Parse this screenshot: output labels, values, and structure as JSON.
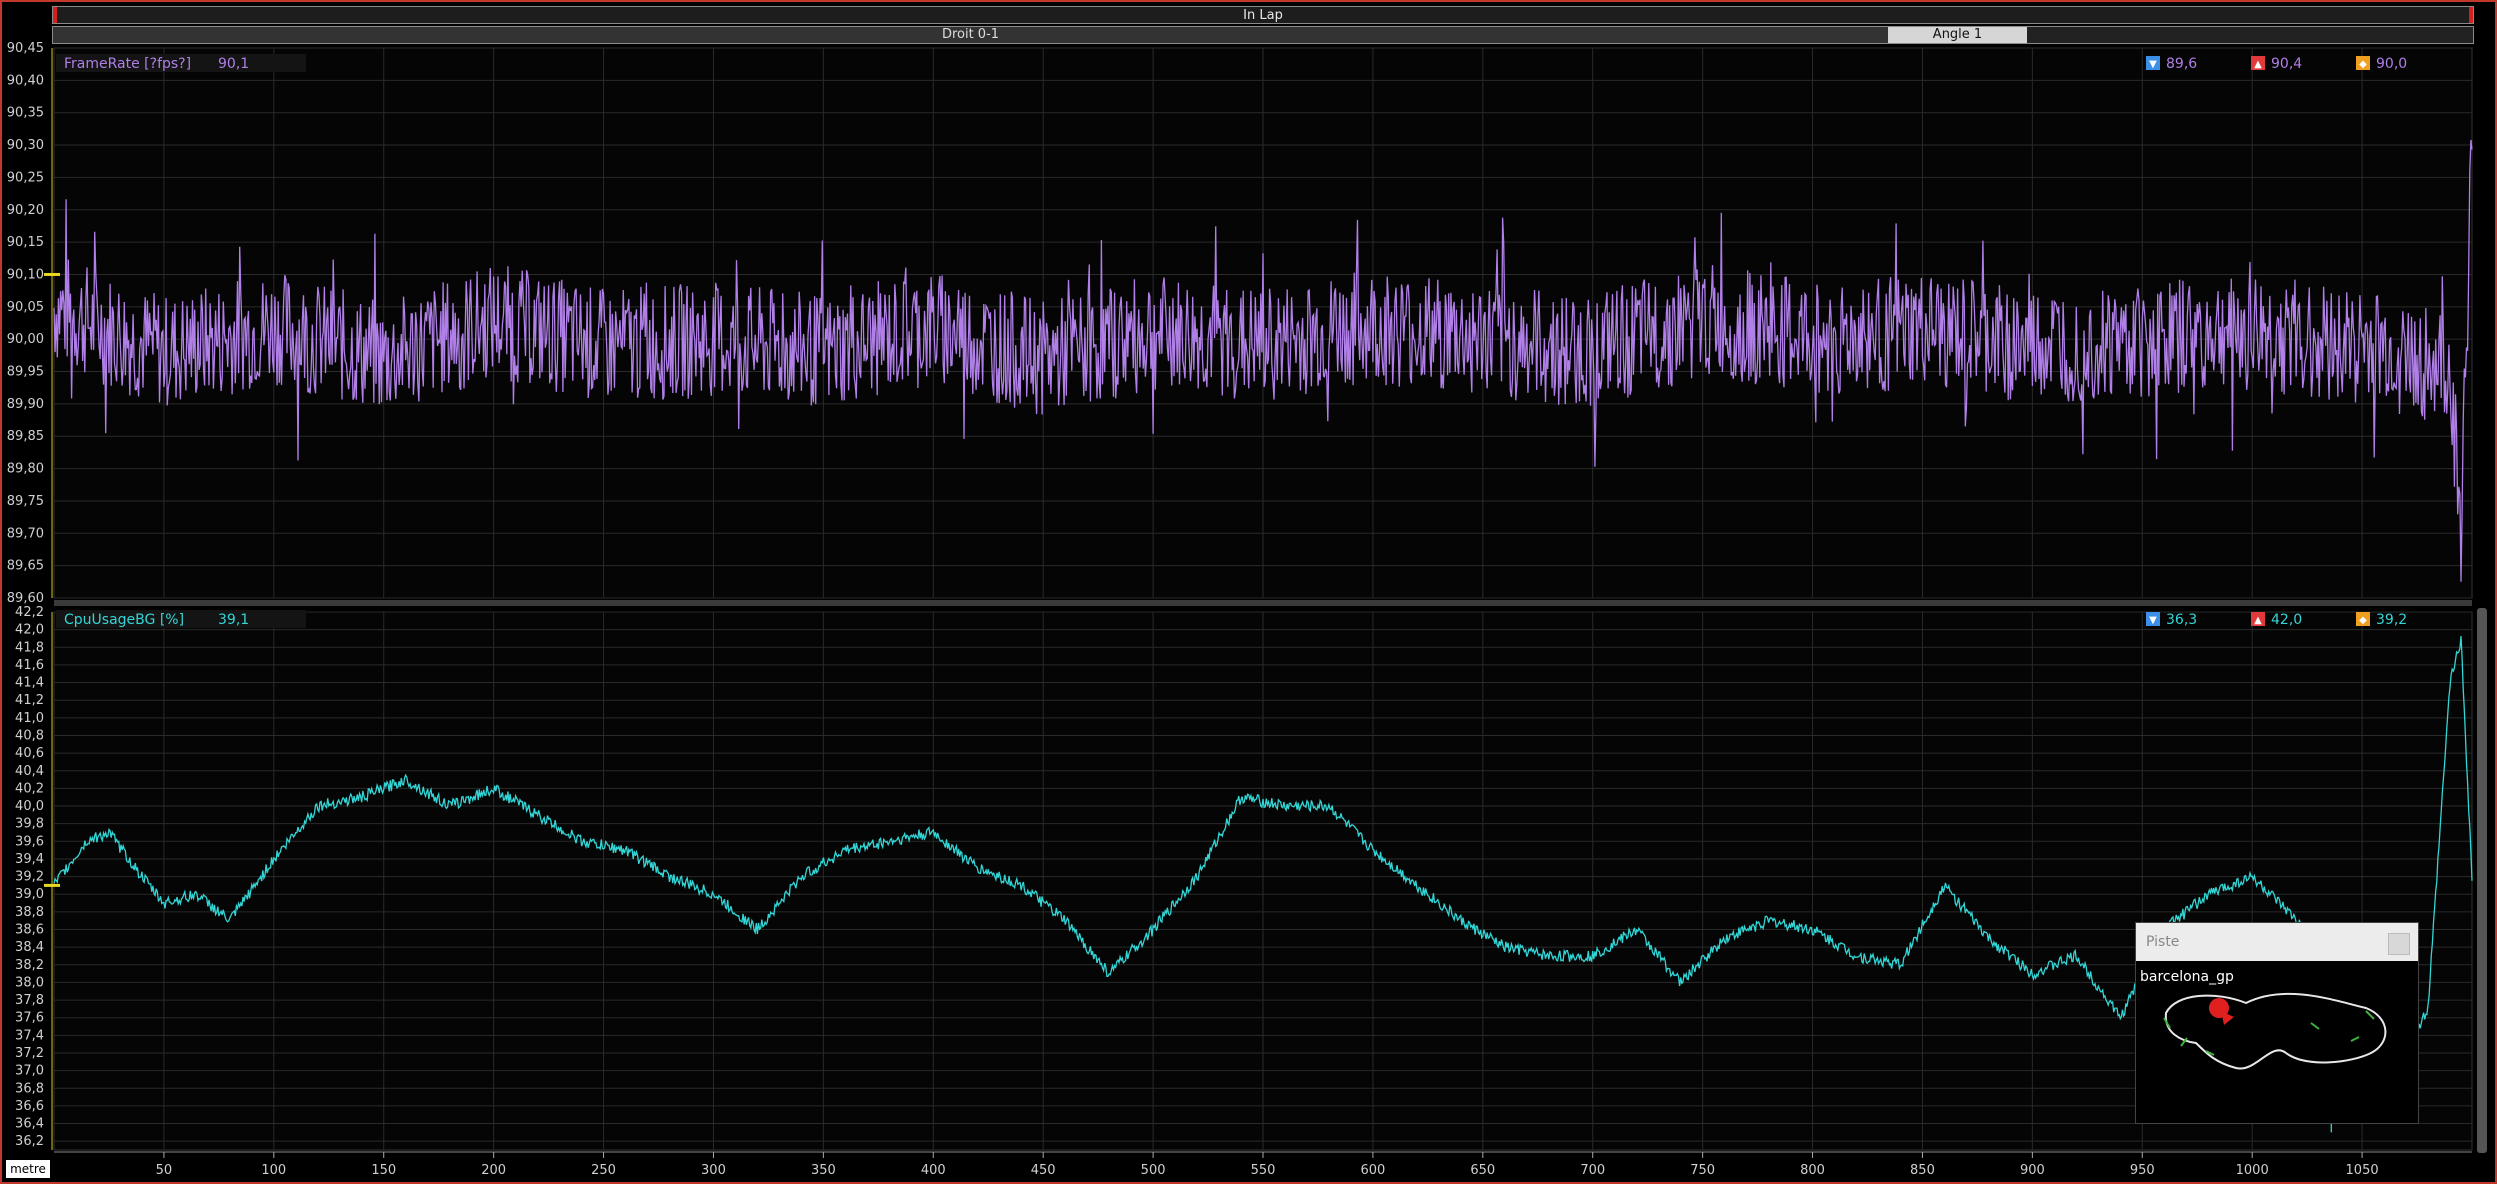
{
  "top": {
    "lap_label": "In Lap",
    "segments": [
      "Droit 0-1",
      "Angle 1"
    ]
  },
  "x_unit": "metre",
  "minimap": {
    "title": "Piste",
    "track_name": "barcelona_gp"
  },
  "colors": {
    "framerate": "#b07fe8",
    "cpu": "#33d6d6",
    "grid": "#2a2a2a",
    "min": "#3c8ee6",
    "max": "#e23a3a",
    "avg": "#f0a020"
  },
  "chart_data": [
    {
      "type": "line",
      "series": [
        {
          "name": "FrameRate [?fps?]",
          "current": "90,1",
          "min": "89,6",
          "max": "90,4",
          "avg": "90,0"
        }
      ],
      "ylim": [
        89.6,
        90.45
      ],
      "yticks": [
        "90,45",
        "90,40",
        "90,35",
        "90,30",
        "90,25",
        "90,20",
        "90,15",
        "90,10",
        "90,05",
        "90,00",
        "89,95",
        "89,90",
        "89,85",
        "89,80",
        "89,75",
        "89,70",
        "89,65",
        "89,60"
      ],
      "xlim": [
        0,
        1100
      ],
      "x": [
        0,
        50,
        100,
        150,
        200,
        250,
        300,
        350,
        400,
        450,
        500,
        550,
        600,
        650,
        700,
        750,
        800,
        850,
        900,
        950,
        1000,
        1050,
        1090,
        1095,
        1100
      ],
      "y": [
        90.05,
        89.98,
        90.02,
        89.97,
        90.03,
        89.99,
        90.0,
        89.98,
        90.02,
        89.97,
        90.01,
        89.99,
        90.02,
        90.0,
        89.98,
        90.03,
        90.0,
        90.01,
        89.99,
        90.0,
        90.01,
        89.99,
        89.95,
        89.7,
        90.3
      ]
    },
    {
      "type": "line",
      "series": [
        {
          "name": "CpuUsageBG [%]",
          "current": "39,1",
          "min": "36,3",
          "max": "42,0",
          "avg": "39,2"
        }
      ],
      "ylim": [
        36.1,
        42.2
      ],
      "yticks": [
        "42,2",
        "42,0",
        "41,8",
        "41,6",
        "41,4",
        "41,2",
        "41,0",
        "40,8",
        "40,6",
        "40,4",
        "40,2",
        "40,0",
        "39,8",
        "39,6",
        "39,4",
        "39,2",
        "39,0",
        "38,8",
        "38,6",
        "38,4",
        "38,2",
        "38,0",
        "37,8",
        "37,6",
        "37,4",
        "37,2",
        "37,0",
        "36,8",
        "36,6",
        "36,4",
        "36,2"
      ],
      "xlim": [
        0,
        1100
      ],
      "x": [
        0,
        15,
        25,
        40,
        50,
        65,
        80,
        100,
        120,
        140,
        160,
        180,
        200,
        220,
        240,
        260,
        280,
        300,
        320,
        340,
        360,
        380,
        400,
        420,
        440,
        460,
        480,
        500,
        520,
        540,
        560,
        580,
        600,
        620,
        640,
        660,
        680,
        700,
        720,
        740,
        760,
        780,
        800,
        820,
        840,
        860,
        880,
        900,
        920,
        940,
        960,
        980,
        1000,
        1020,
        1040,
        1060,
        1070,
        1080,
        1090,
        1095,
        1100
      ],
      "y": [
        39.1,
        39.6,
        39.7,
        39.2,
        38.9,
        39.0,
        38.7,
        39.4,
        40.0,
        40.1,
        40.3,
        40.0,
        40.2,
        39.9,
        39.6,
        39.5,
        39.2,
        39.0,
        38.6,
        39.2,
        39.5,
        39.6,
        39.7,
        39.3,
        39.1,
        38.7,
        38.1,
        38.6,
        39.2,
        40.1,
        40.0,
        40.0,
        39.5,
        39.1,
        38.7,
        38.4,
        38.3,
        38.3,
        38.6,
        38.0,
        38.5,
        38.7,
        38.6,
        38.3,
        38.2,
        39.1,
        38.5,
        38.1,
        38.3,
        37.6,
        38.6,
        39.0,
        39.2,
        38.7,
        38.0,
        37.6,
        37.2,
        37.7,
        41.4,
        41.9,
        39.2
      ],
      "min_dip": {
        "x": 1036,
        "y": 36.3
      }
    }
  ],
  "xaxis": {
    "ticks": [
      50,
      100,
      150,
      200,
      250,
      300,
      350,
      400,
      450,
      500,
      550,
      600,
      650,
      700,
      750,
      800,
      850,
      900,
      950,
      1000,
      1050
    ]
  }
}
